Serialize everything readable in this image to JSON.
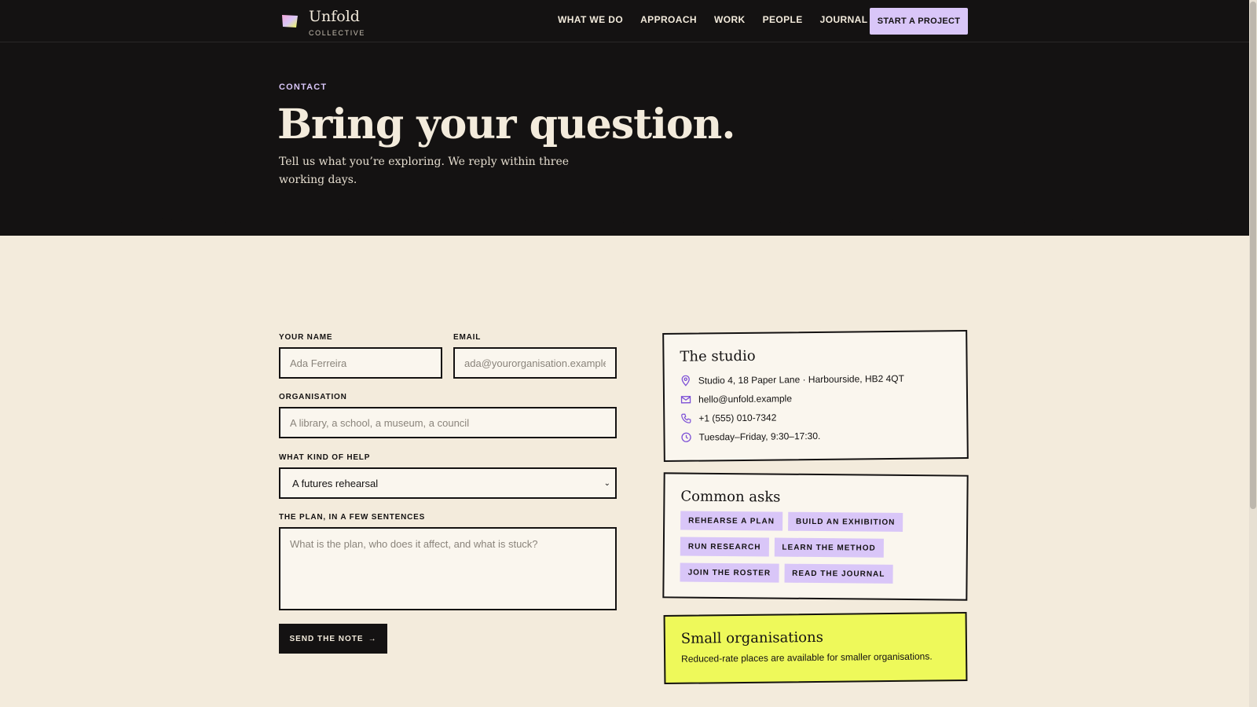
{
  "brand": {
    "name": "Unfold",
    "sub": "COLLECTIVE"
  },
  "nav": {
    "items": [
      "WHAT WE DO",
      "APPROACH",
      "WORK",
      "PEOPLE",
      "JOURNAL"
    ],
    "cta": "START A PROJECT"
  },
  "hero": {
    "eyebrow": "CONTACT",
    "title": "Bring your question.",
    "lede": "Tell us what you’re exploring. We reply within three working days."
  },
  "form": {
    "name_label": "YOUR NAME",
    "name_placeholder": "Ada Ferreira",
    "email_label": "EMAIL",
    "email_placeholder": "ada@yourorganisation.example",
    "org_label": "ORGANISATION",
    "org_placeholder": "A library, a school, a museum, a council",
    "help_label": "WHAT KIND OF HELP",
    "help_value": "A futures rehearsal",
    "plan_label": "THE PLAN, IN A FEW SENTENCES",
    "plan_placeholder": "What is the plan, who does it affect, and what is stuck?",
    "submit": "SEND THE NOTE",
    "submit_arrow": "→"
  },
  "studio": {
    "title": "The studio",
    "address": "Studio 4, 18 Paper Lane · Harbourside, HB2 4QT",
    "email": "hello@unfold.example",
    "phone": "+1 (555) 010-7342",
    "hours": "Tuesday–Friday, 9:30–17:30."
  },
  "asks": {
    "title": "Common asks",
    "chips": [
      "REHEARSE A PLAN",
      "BUILD AN EXHIBITION",
      "RUN RESEARCH",
      "LEARN THE METHOD",
      "JOIN THE ROSTER",
      "READ THE JOURNAL"
    ]
  },
  "small_orgs": {
    "title": "Small organisations",
    "text": "Reduced-rate places are available for smaller organisations."
  },
  "icons": [
    "pin-icon",
    "mail-icon",
    "phone-icon",
    "clock-icon",
    "chevron-down-icon",
    "arrow-right-icon"
  ],
  "colors": {
    "ink": "#141212",
    "paper": "#f3ebdc",
    "lilac": "#d9c6f8",
    "lime": "#eef95a"
  }
}
